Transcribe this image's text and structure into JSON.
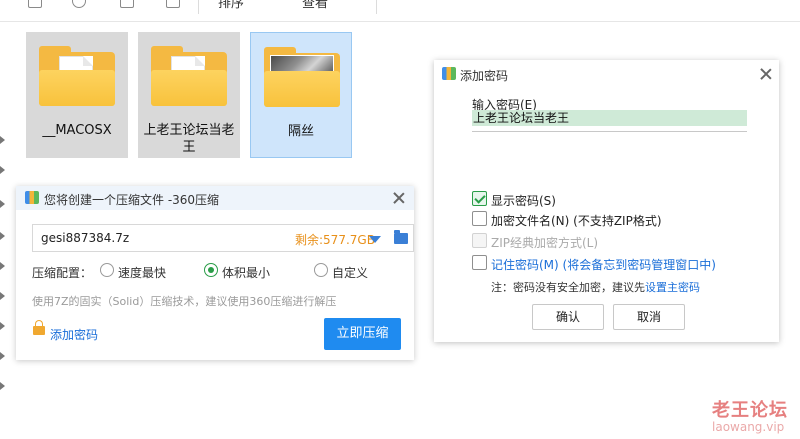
{
  "toolbar": {
    "sort_label": "排序",
    "view_label": "查看"
  },
  "files": [
    {
      "name": "__MACOSX",
      "kind": "folder-doc",
      "selected": false
    },
    {
      "name": "上老王论坛当老王",
      "kind": "folder-doc",
      "selected": false
    },
    {
      "name": "隔丝",
      "kind": "folder-photo",
      "selected": true
    }
  ],
  "compress_dialog": {
    "title": "您将创建一个压缩文件 -360压缩",
    "filename": "gesi887384.7z",
    "free_space": "剩余:577.7GB",
    "config_label": "压缩配置：",
    "options": [
      "速度最快",
      "体积最小",
      "自定义"
    ],
    "selected_option": "体积最小",
    "hint": "使用7Z的固实（Solid）压缩技术，建议使用360压缩进行解压",
    "add_password": "添加密码",
    "compress_button": "立即压缩"
  },
  "password_dialog": {
    "title": "添加密码",
    "input_label": "输入密码(E)",
    "password_value": "上老王论坛当老王",
    "show_password": "显示密码(S)",
    "show_password_checked": true,
    "encrypt_filenames": "加密文件名(N) (不支持ZIP格式)",
    "encrypt_filenames_checked": false,
    "zip_classic": "ZIP经典加密方式(L)",
    "zip_classic_enabled": false,
    "remember_password": "记住密码(M) (将会备忘到密码管理窗口中)",
    "remember_password_checked": false,
    "note_prefix": "注：密码没有安全加密，建议先",
    "note_link": "设置主密码",
    "ok_button": "确认",
    "cancel_button": "取消"
  },
  "watermark": {
    "line1": "老王论坛",
    "line2": "laowang.vip"
  },
  "colors": {
    "accent": "#1f8bf0",
    "link": "#1a6ed8",
    "free_space": "#e8901a",
    "selection": "#cfe5fb",
    "checked": "#2a9d48"
  }
}
